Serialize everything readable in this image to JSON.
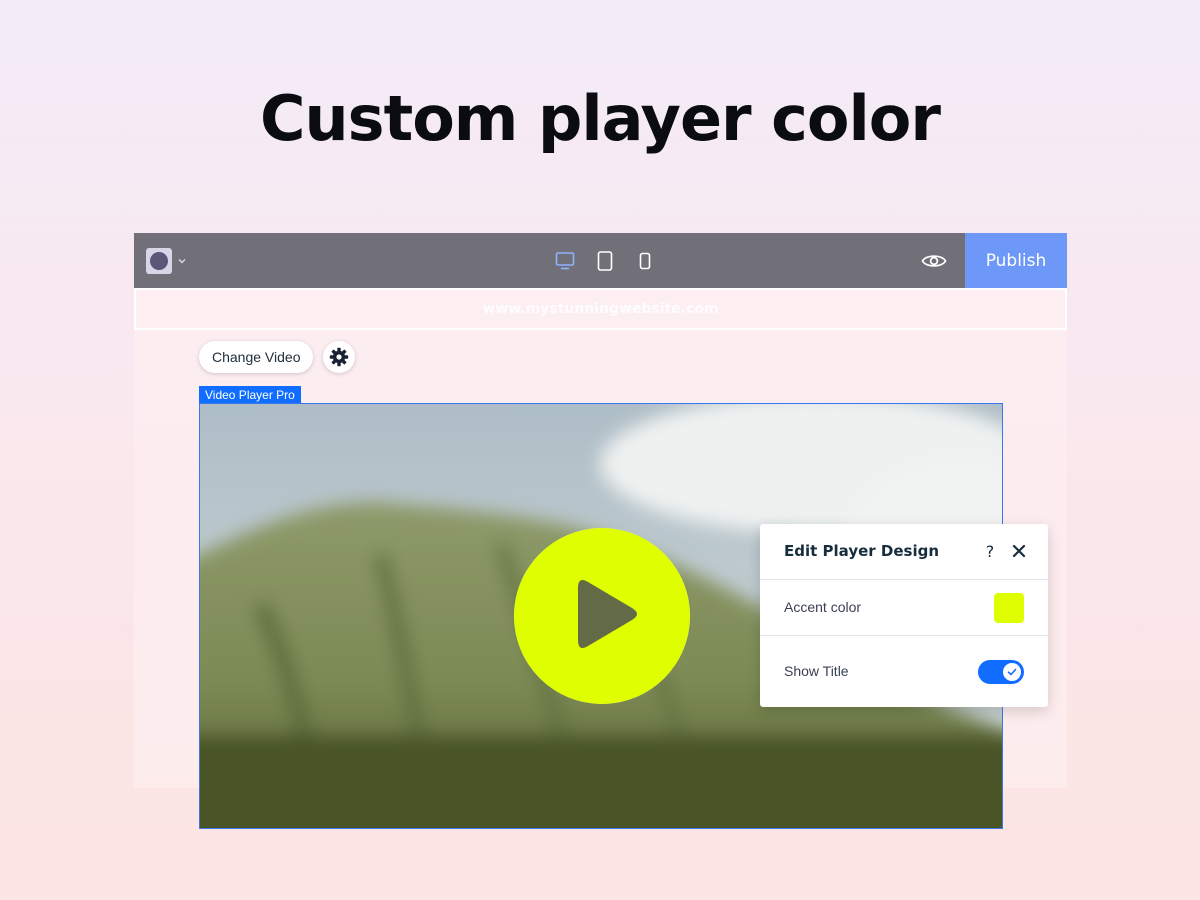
{
  "headline": "Custom player color",
  "editor": {
    "url": "www.mystunningwebsite.com",
    "publish_label": "Publish",
    "change_video_label": "Change Video",
    "component_tag": "Video Player Pro"
  },
  "panel": {
    "title": "Edit Player Design",
    "help_label": "?",
    "accent_label": "Accent color",
    "accent_color": "#dfff00",
    "show_title_label": "Show Title",
    "show_title_on": true
  },
  "colors": {
    "topbar": "#716f77",
    "publish": "#6e98f8",
    "selection": "#116dff",
    "accent": "#dfff00"
  }
}
